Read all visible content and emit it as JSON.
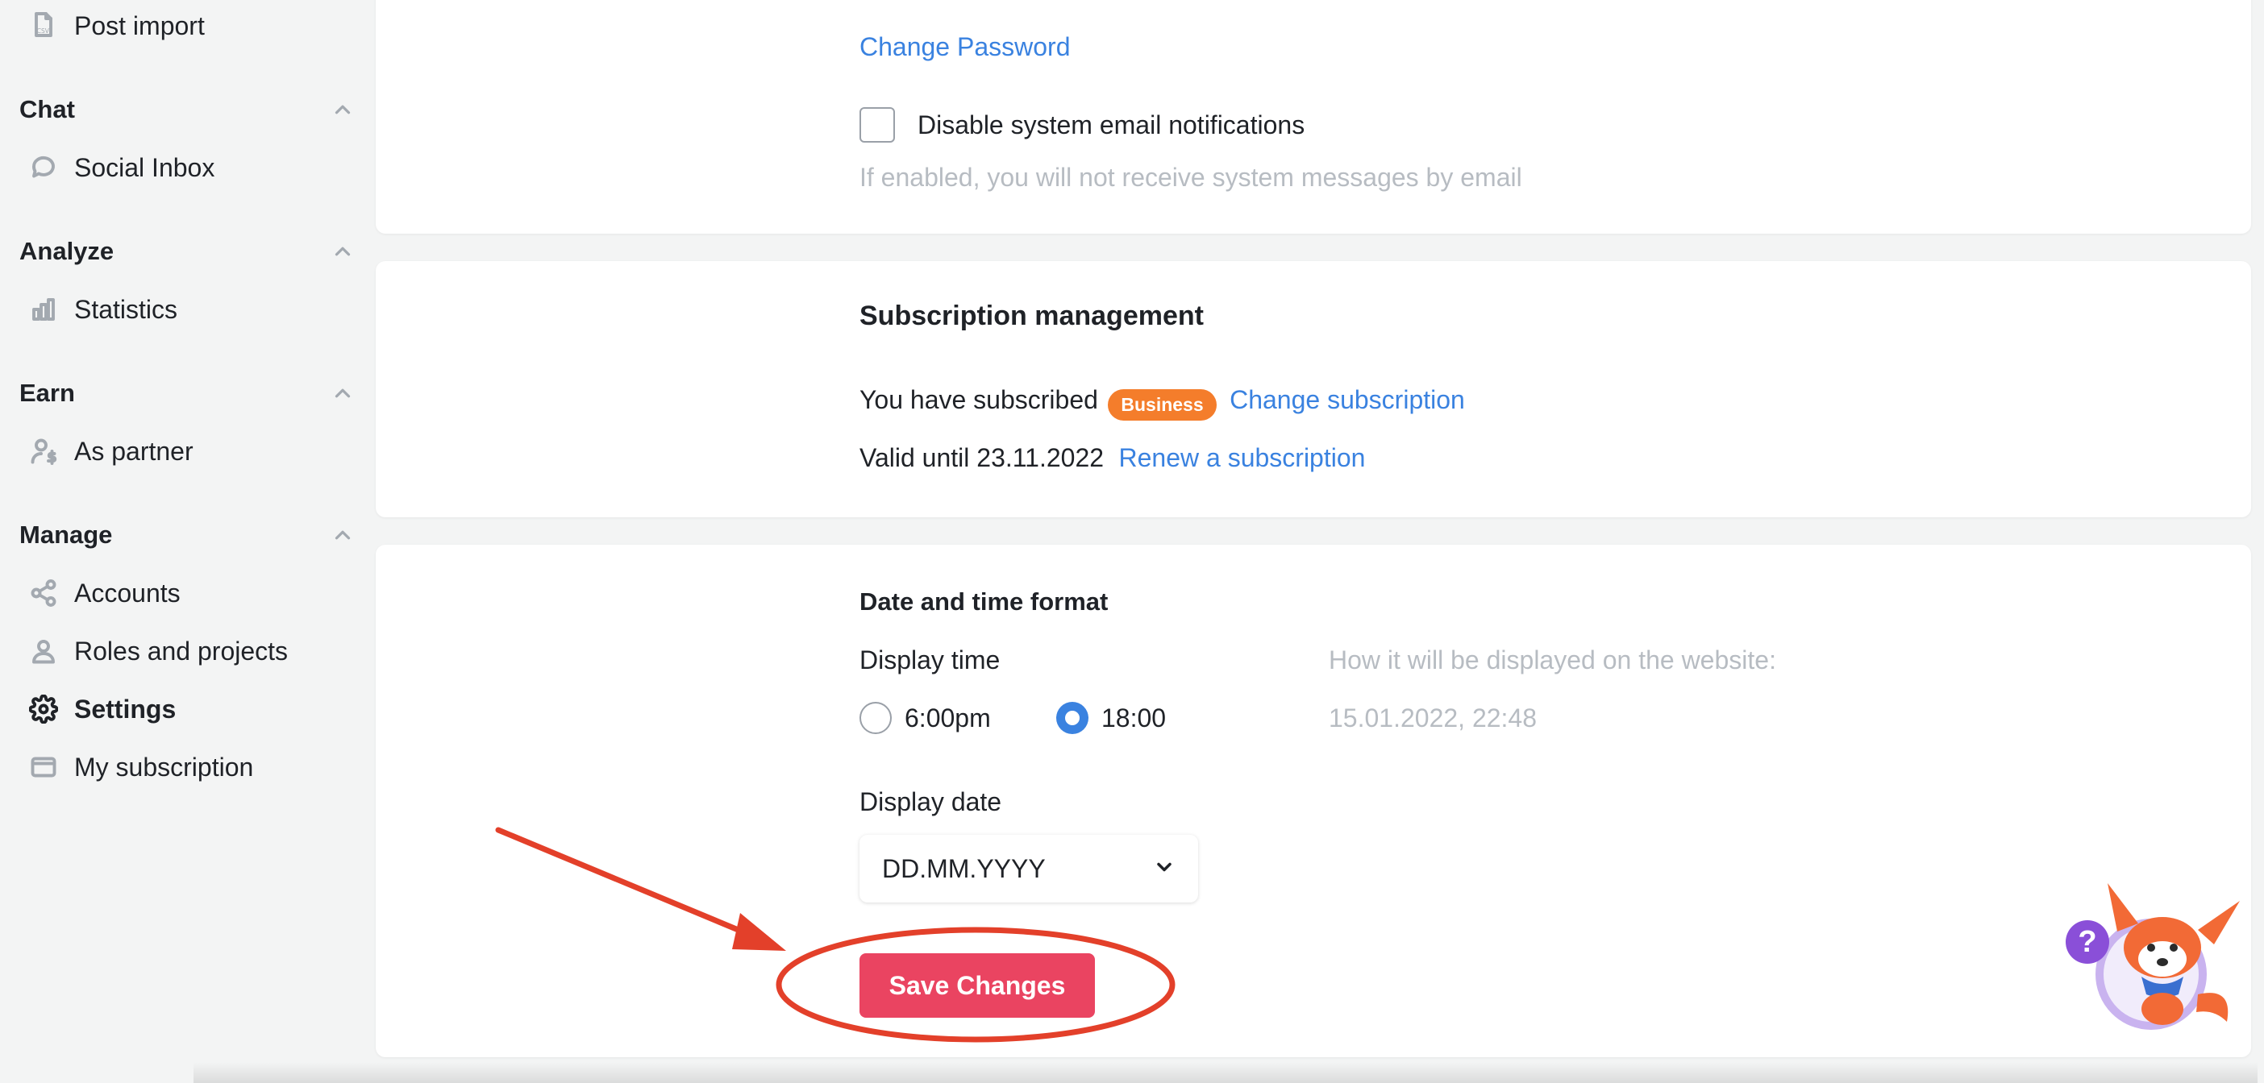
{
  "sidebar": {
    "top_item": {
      "label": "Post import",
      "icon": "csv-file-icon"
    },
    "sections": [
      {
        "title": "Chat",
        "items": [
          {
            "label": "Social Inbox",
            "icon": "chat-bubble-icon"
          }
        ]
      },
      {
        "title": "Analyze",
        "items": [
          {
            "label": "Statistics",
            "icon": "bar-chart-icon"
          }
        ]
      },
      {
        "title": "Earn",
        "items": [
          {
            "label": "As partner",
            "icon": "partner-dollar-icon"
          }
        ]
      },
      {
        "title": "Manage",
        "items": [
          {
            "label": "Accounts",
            "icon": "share-icon"
          },
          {
            "label": "Roles and projects",
            "icon": "users-icon"
          },
          {
            "label": "Settings",
            "icon": "gear-icon",
            "active": true
          },
          {
            "label": "My subscription",
            "icon": "card-icon"
          }
        ]
      }
    ]
  },
  "account": {
    "change_password": "Change Password",
    "disable_notifications_label": "Disable system email notifications",
    "disable_notifications_checked": false,
    "disable_notifications_hint": "If enabled, you will not receive system messages by email"
  },
  "subscription": {
    "title": "Subscription management",
    "subscribed_text": "You have subscribed",
    "plan_badge": "Business",
    "change_link": "Change subscription",
    "valid_text": "Valid until 23.11.2022",
    "renew_link": "Renew a subscription"
  },
  "datetime": {
    "title": "Date and time format",
    "display_time_label": "Display time",
    "time_options": [
      "6:00pm",
      "18:00"
    ],
    "time_selected": "18:00",
    "preview_label": "How it will be displayed on the website:",
    "preview_value": "15.01.2022, 22:48",
    "display_date_label": "Display date",
    "date_format_value": "DD.MM.YYYY",
    "save_button": "Save Changes"
  },
  "help": {
    "symbol": "?"
  },
  "colors": {
    "link": "#3a82e0",
    "save_button": "#ea4461",
    "badge": "#f47d2b",
    "annotation": "#e3402a",
    "help": "#8a4fd8"
  }
}
